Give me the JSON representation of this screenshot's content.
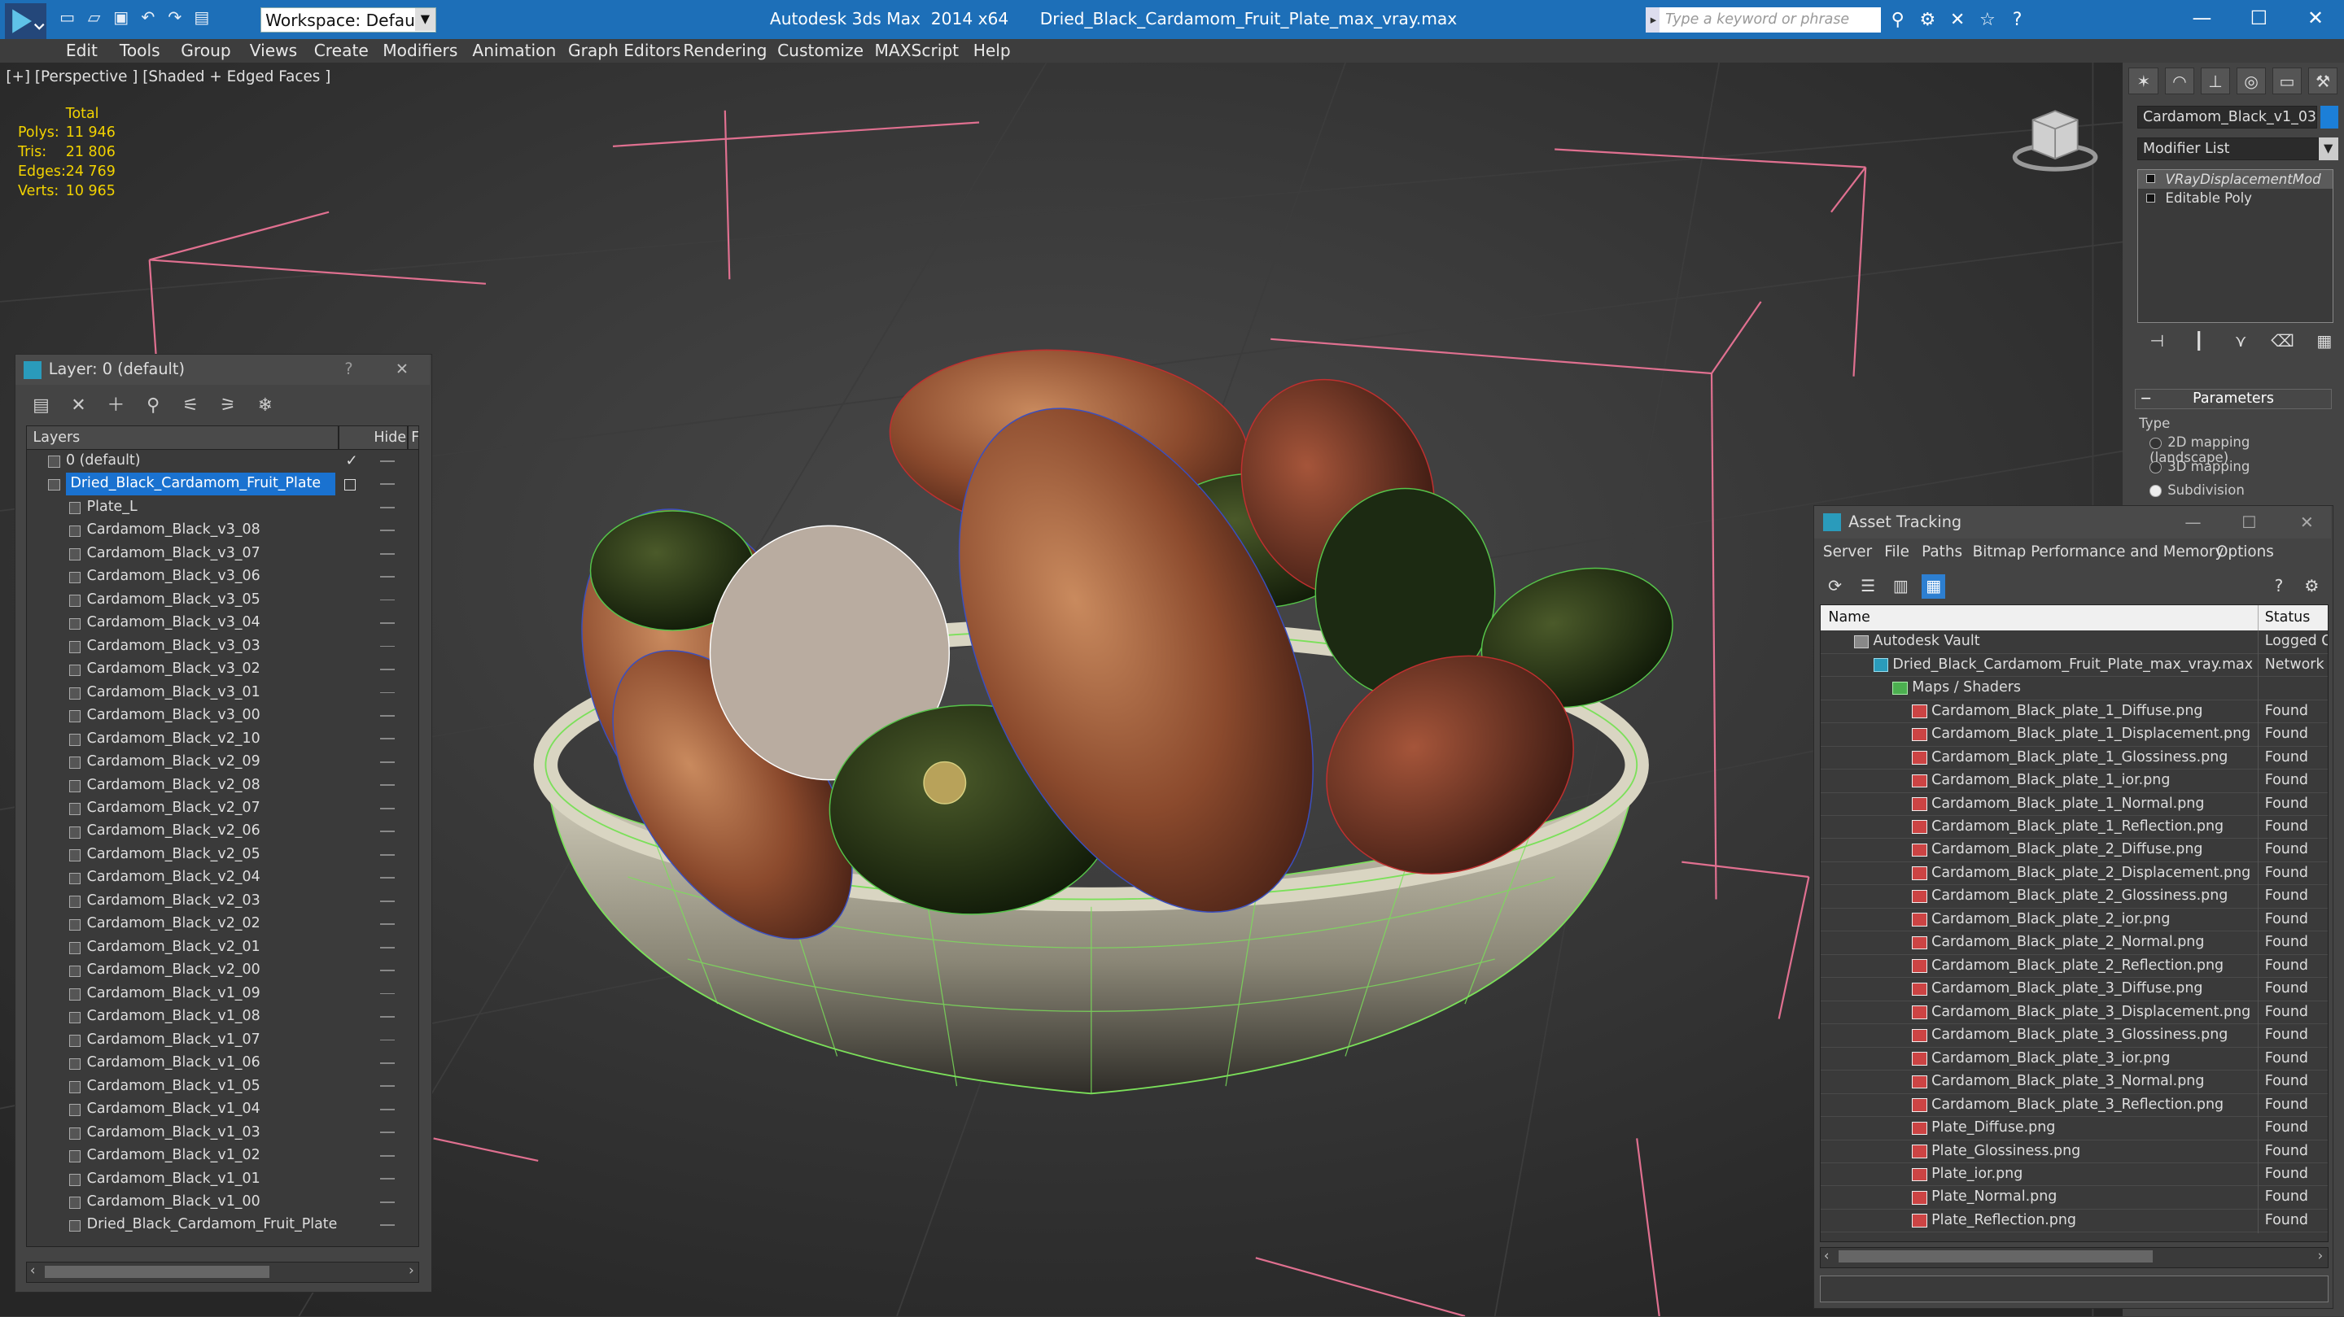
{
  "titlebar": {
    "workspace": "Workspace: Default",
    "app_name": "Autodesk 3ds Max  2014 x64",
    "file_name": "Dried_Black_Cardamom_Fruit_Plate_max_vray.max",
    "search_placeholder": "Type a keyword or phrase"
  },
  "menu": [
    "Edit",
    "Tools",
    "Group",
    "Views",
    "Create",
    "Modifiers",
    "Animation",
    "Graph Editors",
    "Rendering",
    "Customize",
    "MAXScript",
    "Help"
  ],
  "viewport": {
    "label": "[+] [Perspective ] [Shaded + Edged Faces ]",
    "stats_header": "Total",
    "stats": [
      {
        "k": "Polys:",
        "v": "11 946"
      },
      {
        "k": "Tris:",
        "v": "21 806"
      },
      {
        "k": "Edges:",
        "v": "24 769"
      },
      {
        "k": "Verts:",
        "v": "10 965"
      }
    ]
  },
  "command_panel": {
    "object_name": "Cardamom_Black_v1_03",
    "object_color": "#1c7fd8",
    "modifier_list": "Modifier List",
    "stack": [
      "VRayDisplacementMod",
      "Editable Poly"
    ],
    "parameters": "Parameters",
    "type_label": "Type",
    "options": [
      "2D mapping (landscape)",
      "3D mapping",
      "Subdivision"
    ],
    "selected_option": "Subdivision"
  },
  "layer_dialog": {
    "title": "Layer: 0 (default)",
    "help": "?",
    "col_layers": "Layers",
    "col_hide": "Hide",
    "col_f": "F",
    "layers": [
      "0 (default)",
      "Dried_Black_Cardamom_Fruit_Plate"
    ],
    "objects": [
      "Plate_L",
      "Cardamom_Black_v3_08",
      "Cardamom_Black_v3_07",
      "Cardamom_Black_v3_06",
      "Cardamom_Black_v3_05",
      "Cardamom_Black_v3_04",
      "Cardamom_Black_v3_03",
      "Cardamom_Black_v3_02",
      "Cardamom_Black_v3_01",
      "Cardamom_Black_v3_00",
      "Cardamom_Black_v2_10",
      "Cardamom_Black_v2_09",
      "Cardamom_Black_v2_08",
      "Cardamom_Black_v2_07",
      "Cardamom_Black_v2_06",
      "Cardamom_Black_v2_05",
      "Cardamom_Black_v2_04",
      "Cardamom_Black_v2_03",
      "Cardamom_Black_v2_02",
      "Cardamom_Black_v2_01",
      "Cardamom_Black_v2_00",
      "Cardamom_Black_v1_09",
      "Cardamom_Black_v1_08",
      "Cardamom_Black_v1_07",
      "Cardamom_Black_v1_06",
      "Cardamom_Black_v1_05",
      "Cardamom_Black_v1_04",
      "Cardamom_Black_v1_03",
      "Cardamom_Black_v1_02",
      "Cardamom_Black_v1_01",
      "Cardamom_Black_v1_00",
      "Dried_Black_Cardamom_Fruit_Plate"
    ]
  },
  "asset_tracking": {
    "title": "Asset Tracking",
    "menu": [
      "Server",
      "File",
      "Paths",
      "Bitmap Performance and Memory",
      "Options"
    ],
    "col_name": "Name",
    "col_status": "Status",
    "vault": {
      "name": "Autodesk Vault",
      "status": "Logged O"
    },
    "file": {
      "name": "Dried_Black_Cardamom_Fruit_Plate_max_vray.max",
      "status": "Network F"
    },
    "maps_folder": "Maps / Shaders",
    "maps": [
      {
        "name": "Cardamom_Black_plate_1_Diffuse.png",
        "status": "Found"
      },
      {
        "name": "Cardamom_Black_plate_1_Displacement.png",
        "status": "Found"
      },
      {
        "name": "Cardamom_Black_plate_1_Glossiness.png",
        "status": "Found"
      },
      {
        "name": "Cardamom_Black_plate_1_ior.png",
        "status": "Found"
      },
      {
        "name": "Cardamom_Black_plate_1_Normal.png",
        "status": "Found"
      },
      {
        "name": "Cardamom_Black_plate_1_Reflection.png",
        "status": "Found"
      },
      {
        "name": "Cardamom_Black_plate_2_Diffuse.png",
        "status": "Found"
      },
      {
        "name": "Cardamom_Black_plate_2_Displacement.png",
        "status": "Found"
      },
      {
        "name": "Cardamom_Black_plate_2_Glossiness.png",
        "status": "Found"
      },
      {
        "name": "Cardamom_Black_plate_2_ior.png",
        "status": "Found"
      },
      {
        "name": "Cardamom_Black_plate_2_Normal.png",
        "status": "Found"
      },
      {
        "name": "Cardamom_Black_plate_2_Reflection.png",
        "status": "Found"
      },
      {
        "name": "Cardamom_Black_plate_3_Diffuse.png",
        "status": "Found"
      },
      {
        "name": "Cardamom_Black_plate_3_Displacement.png",
        "status": "Found"
      },
      {
        "name": "Cardamom_Black_plate_3_Glossiness.png",
        "status": "Found"
      },
      {
        "name": "Cardamom_Black_plate_3_ior.png",
        "status": "Found"
      },
      {
        "name": "Cardamom_Black_plate_3_Normal.png",
        "status": "Found"
      },
      {
        "name": "Cardamom_Black_plate_3_Reflection.png",
        "status": "Found"
      },
      {
        "name": "Plate_Diffuse.png",
        "status": "Found"
      },
      {
        "name": "Plate_Glossiness.png",
        "status": "Found"
      },
      {
        "name": "Plate_ior.png",
        "status": "Found"
      },
      {
        "name": "Plate_Normal.png",
        "status": "Found"
      },
      {
        "name": "Plate_Reflection.png",
        "status": "Found"
      }
    ]
  }
}
